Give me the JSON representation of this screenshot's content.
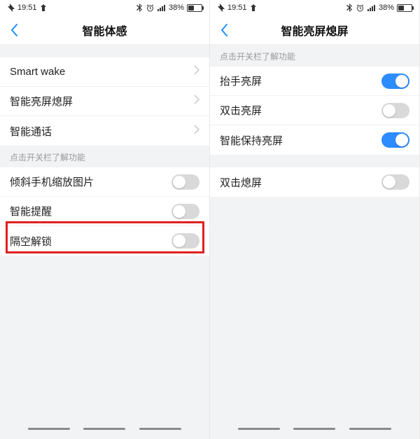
{
  "status": {
    "time": "19:51",
    "battery_percent": "38%"
  },
  "left": {
    "title": "智能体感",
    "section1": {
      "items": [
        {
          "label": "Smart wake"
        },
        {
          "label": "智能亮屏熄屏"
        },
        {
          "label": "智能通话"
        }
      ]
    },
    "section2_header": "点击开关栏了解功能",
    "section2": {
      "items": [
        {
          "label": "倾斜手机缩放图片",
          "on": false
        },
        {
          "label": "智能提醒",
          "on": false
        },
        {
          "label": "隔空解锁",
          "on": false
        }
      ]
    }
  },
  "right": {
    "title": "智能亮屏熄屏",
    "section1_header": "点击开关栏了解功能",
    "section1": {
      "items": [
        {
          "label": "抬手亮屏",
          "on": true
        },
        {
          "label": "双击亮屏",
          "on": false
        },
        {
          "label": "智能保持亮屏",
          "on": true
        }
      ]
    },
    "section2": {
      "items": [
        {
          "label": "双击熄屏",
          "on": false
        }
      ]
    }
  }
}
